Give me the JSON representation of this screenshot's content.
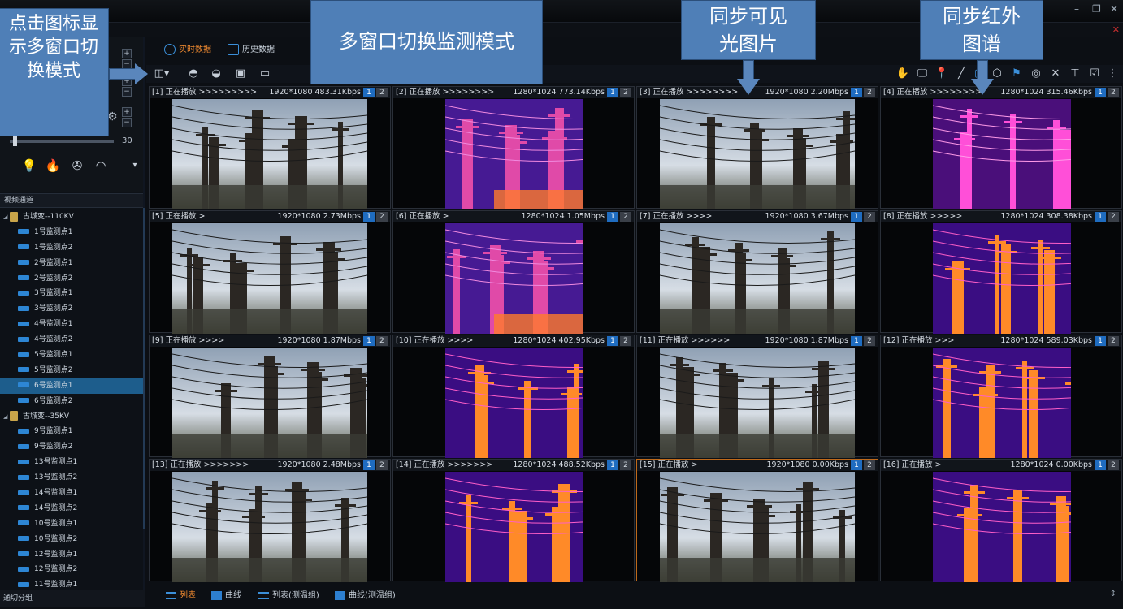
{
  "tabs": [
    {
      "label": "实时数据",
      "active": true
    },
    {
      "label": "历史数据",
      "active": false
    }
  ],
  "left_panel": {
    "slider_value": "30",
    "section_title": "视频通道",
    "footer": "通切分组"
  },
  "tree": [
    {
      "type": "station",
      "label": "古城变--110KV"
    },
    {
      "type": "point",
      "label": "1号监测点1"
    },
    {
      "type": "point",
      "label": "1号监测点2"
    },
    {
      "type": "point",
      "label": "2号监测点1"
    },
    {
      "type": "point",
      "label": "2号监测点2"
    },
    {
      "type": "point",
      "label": "3号监测点1"
    },
    {
      "type": "point",
      "label": "3号监测点2"
    },
    {
      "type": "point",
      "label": "4号监测点1"
    },
    {
      "type": "point",
      "label": "4号监测点2"
    },
    {
      "type": "point",
      "label": "5号监测点1"
    },
    {
      "type": "point",
      "label": "5号监测点2"
    },
    {
      "type": "point",
      "label": "6号监测点1",
      "selected": true
    },
    {
      "type": "point",
      "label": "6号监测点2"
    },
    {
      "type": "station",
      "label": "古城变--35KV"
    },
    {
      "type": "point",
      "label": "9号监测点1"
    },
    {
      "type": "point",
      "label": "9号监测点2"
    },
    {
      "type": "point",
      "label": "13号监测点1"
    },
    {
      "type": "point",
      "label": "13号监测点2"
    },
    {
      "type": "point",
      "label": "14号监测点1"
    },
    {
      "type": "point",
      "label": "14号监测点2"
    },
    {
      "type": "point",
      "label": "10号监测点1"
    },
    {
      "type": "point",
      "label": "10号监测点2"
    },
    {
      "type": "point",
      "label": "12号监测点1"
    },
    {
      "type": "point",
      "label": "12号监测点2"
    },
    {
      "type": "point",
      "label": "11号监测点1"
    }
  ],
  "cells": [
    {
      "label": "[1] 正在播放 >>>>>>>>>",
      "info": "1920*1080 483.31Kbps",
      "kind": "visible"
    },
    {
      "label": "[2] 正在播放 >>>>>>>>",
      "info": "1280*1024 773.14Kbps",
      "kind": "ir-purple"
    },
    {
      "label": "[3] 正在播放 >>>>>>>>",
      "info": "1920*1080 2.20Mbps",
      "kind": "visible"
    },
    {
      "label": "[4] 正在播放 >>>>>>>>",
      "info": "1280*1024 315.46Kbps",
      "kind": "ir-pink"
    },
    {
      "label": "[5] 正在播放 >",
      "info": "1920*1080 2.73Mbps",
      "kind": "visible"
    },
    {
      "label": "[6] 正在播放 >",
      "info": "1280*1024 1.05Mbps",
      "kind": "ir-purple"
    },
    {
      "label": "[7] 正在播放 >>>>",
      "info": "1920*1080 3.67Mbps",
      "kind": "visible"
    },
    {
      "label": "[8] 正在播放 >>>>>",
      "info": "1280*1024 308.38Kbps",
      "kind": "ir-orange"
    },
    {
      "label": "[9] 正在播放 >>>>",
      "info": "1920*1080 1.87Mbps",
      "kind": "visible"
    },
    {
      "label": "[10] 正在播放 >>>>",
      "info": "1280*1024 402.95Kbps",
      "kind": "ir-orange"
    },
    {
      "label": "[11] 正在播放 >>>>>>",
      "info": "1920*1080 1.87Mbps",
      "kind": "visible"
    },
    {
      "label": "[12] 正在播放 >>>",
      "info": "1280*1024 589.03Kbps",
      "kind": "ir-orange"
    },
    {
      "label": "[13] 正在播放 >>>>>>>",
      "info": "1920*1080 2.48Mbps",
      "kind": "visible"
    },
    {
      "label": "[14] 正在播放 >>>>>>>",
      "info": "1280*1024 488.52Kbps",
      "kind": "ir-orange"
    },
    {
      "label": "[15] 正在播放 >",
      "info": "1920*1080 0.00Kbps",
      "kind": "visible",
      "selected": true
    },
    {
      "label": "[16] 正在播放 >",
      "info": "1280*1024 0.00Kbps",
      "kind": "ir-orange"
    }
  ],
  "stream_badges": [
    "1",
    "2"
  ],
  "bottom_tabs": [
    {
      "label": "列表",
      "active": true
    },
    {
      "label": "曲线",
      "active": false
    },
    {
      "label": "列表(测温组)",
      "active": false
    },
    {
      "label": "曲线(测温组)",
      "active": false
    }
  ],
  "callouts": {
    "left": "点击图标显示多窗口切换模式",
    "top": "多窗口切换监测模式",
    "visible": "同步可见光图片",
    "infrared": "同步红外图谱"
  }
}
